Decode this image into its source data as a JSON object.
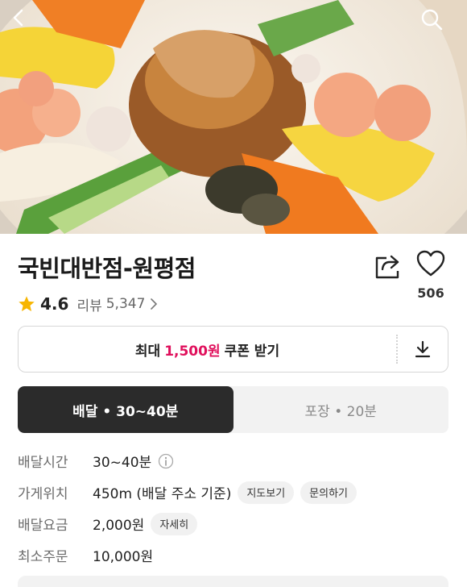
{
  "header": {
    "back_icon": "chevron-left-icon",
    "search_icon": "search-icon",
    "hero_image": "jjajang noodle platter with shrimp, cucumber, egg, squid"
  },
  "store": {
    "name": "국빈대반점-원평점",
    "like_count": "506",
    "rating": "4.6",
    "review_label": "리뷰",
    "review_count": "5,347"
  },
  "coupon": {
    "prefix": "최대",
    "amount": "1,500원",
    "suffix": "쿠폰 받기",
    "accent_color": "#e0105c"
  },
  "tabs": [
    {
      "label": "배달 • 30~40분",
      "active": true
    },
    {
      "label": "포장 • 20분",
      "active": false
    }
  ],
  "info": {
    "delivery_time_label": "배달시간",
    "delivery_time_value": "30~40분",
    "location_label": "가게위치",
    "location_value": "450m (배달 주소 기준)",
    "map_button": "지도보기",
    "inquiry_button": "문의하기",
    "fee_label": "배달요금",
    "fee_value": "2,000원",
    "fee_detail_button": "자세히",
    "min_order_label": "최소주문",
    "min_order_value": "10,000원"
  }
}
